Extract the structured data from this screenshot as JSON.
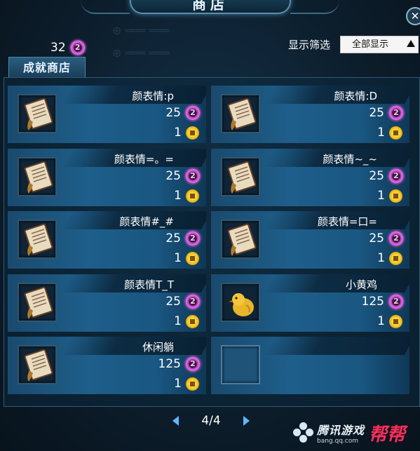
{
  "window": {
    "title": "商店",
    "close_glyph": "✕"
  },
  "currency": {
    "points": "32"
  },
  "filter": {
    "label": "显示筛选",
    "selected": "全部显示"
  },
  "tab": {
    "label": "成就商店"
  },
  "items": [
    {
      "name": "颜表情:p",
      "price": "25",
      "qty": "1",
      "icon": "scroll-icon"
    },
    {
      "name": "颜表情:D",
      "price": "25",
      "qty": "1",
      "icon": "scroll-icon"
    },
    {
      "name": "颜表情=。=",
      "price": "25",
      "qty": "1",
      "icon": "scroll-icon"
    },
    {
      "name": "颜表情~_~",
      "price": "25",
      "qty": "1",
      "icon": "scroll-icon"
    },
    {
      "name": "颜表情#_#",
      "price": "25",
      "qty": "1",
      "icon": "scroll-icon"
    },
    {
      "name": "颜表情=口=",
      "price": "25",
      "qty": "1",
      "icon": "scroll-icon"
    },
    {
      "name": "颜表情T_T",
      "price": "25",
      "qty": "1",
      "icon": "scroll-icon"
    },
    {
      "name": "小黄鸡",
      "price": "125",
      "qty": "1",
      "icon": "chick-icon"
    },
    {
      "name": "休闲躺",
      "price": "125",
      "qty": "1",
      "icon": "scroll-icon"
    }
  ],
  "pagination": {
    "current": "4/4"
  },
  "watermark": {
    "text": "腾讯游戏",
    "url": "bang.qq.com",
    "brand": "帮帮"
  }
}
